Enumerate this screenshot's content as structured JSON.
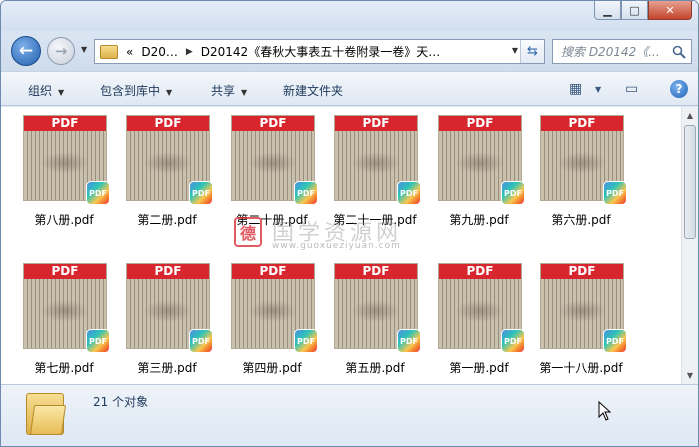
{
  "window": {
    "minimize": "▁",
    "maximize": "□",
    "close": "✕"
  },
  "nav": {
    "back_icon": "←",
    "forward_icon": "→",
    "dropdown": "▼",
    "address": {
      "prefix": "«",
      "segment1": "D20…",
      "segment2": "D20142《春秋大事表五十卷附录一卷》天…",
      "dropdown": "▼",
      "refresh_icon": "⇆"
    },
    "search_placeholder": "搜索 D20142《..."
  },
  "toolbar": {
    "organize": "组织",
    "include_in_library": "包含到库中",
    "share": "共享",
    "new_folder": "新建文件夹",
    "view_icon": "▦",
    "preview_icon": "▭",
    "help": "?"
  },
  "thumbnail_band": "PDF",
  "badge_label": "PDF",
  "files": [
    {
      "name": "第八册.pdf"
    },
    {
      "name": "第二册.pdf"
    },
    {
      "name": "第二十册.pdf"
    },
    {
      "name": "第二十一册.pdf"
    },
    {
      "name": "第九册.pdf"
    },
    {
      "name": "第六册.pdf"
    },
    {
      "name": "第七册.pdf"
    },
    {
      "name": "第三册.pdf"
    },
    {
      "name": "第四册.pdf"
    },
    {
      "name": "第五册.pdf"
    },
    {
      "name": "第一册.pdf"
    },
    {
      "name": "第一十八册.pdf"
    }
  ],
  "watermark": {
    "seal": "德",
    "text": "国学资源网",
    "url": "www.guoxueziyuan.com"
  },
  "status": {
    "count_text": "21 个对象"
  },
  "colors": {
    "pdf_red": "#d8262e",
    "toolbar_text": "#1e395b"
  }
}
